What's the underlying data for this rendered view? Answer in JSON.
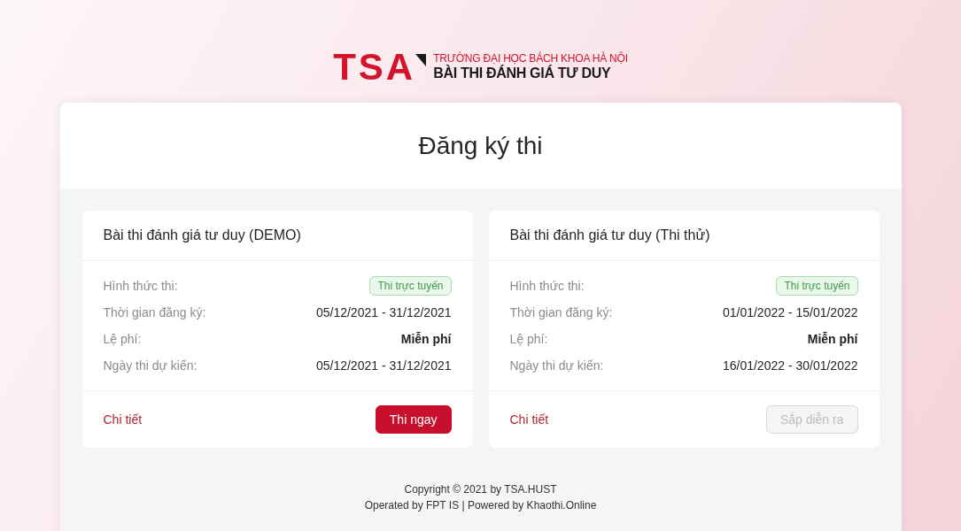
{
  "logo": {
    "brand": "TSA",
    "university": "TRƯỜNG ĐẠI HỌC BÁCH KHOA HÀ NỘI",
    "product": "BÀI THI ĐÁNH GIÁ TƯ DUY"
  },
  "page": {
    "title": "Đăng ký thi"
  },
  "exams": [
    {
      "title": "Bài thi đánh giá tư duy (DEMO)",
      "rows": [
        {
          "label": "Hình thức thi:",
          "value": "Thi trực tuyến",
          "kind": "badge"
        },
        {
          "label": "Thời gian đăng ký:",
          "value": "05/12/2021 - 31/12/2021",
          "kind": "text"
        },
        {
          "label": "Lệ phí:",
          "value": "Miễn phí",
          "kind": "strong"
        },
        {
          "label": "Ngày thi dự kiến:",
          "value": "05/12/2021 - 31/12/2021",
          "kind": "text"
        }
      ],
      "link": "Chi tiết",
      "action": {
        "label": "Thi ngay",
        "disabled": false
      }
    },
    {
      "title": "Bài thi đánh giá tư duy (Thi thử)",
      "rows": [
        {
          "label": "Hình thức thi:",
          "value": "Thi trực tuyến",
          "kind": "badge"
        },
        {
          "label": "Thời gian đăng ký:",
          "value": "01/01/2022 - 15/01/2022",
          "kind": "text"
        },
        {
          "label": "Lệ phí:",
          "value": "Miễn phí",
          "kind": "strong"
        },
        {
          "label": "Ngày thi dự kiến:",
          "value": "16/01/2022 - 30/01/2022",
          "kind": "text"
        }
      ],
      "link": "Chi tiết",
      "action": {
        "label": "Sắp diễn ra",
        "disabled": true
      }
    }
  ],
  "footer": {
    "copyright": "Copyright © 2021 by TSA.HUST",
    "credits": "Operated by FPT IS | Powered by Khaothi.Online"
  }
}
